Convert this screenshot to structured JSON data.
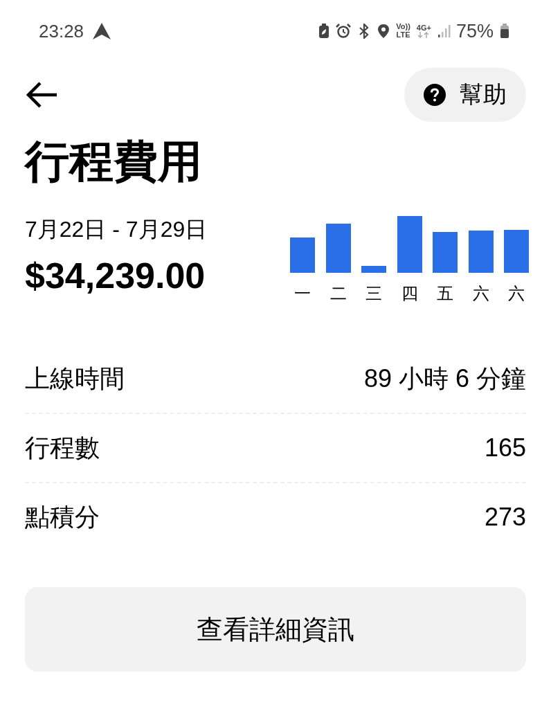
{
  "status_bar": {
    "time": "23:28",
    "volte": "Vo))",
    "lte": "LTE",
    "network": "4G+",
    "battery": "75%"
  },
  "header": {
    "help_button": "幫助"
  },
  "title": "行程費用",
  "summary": {
    "date_range": "7月22日 - 7月29日",
    "amount": "$34,239.00",
    "chart_day_labels": [
      "一",
      "二",
      "三",
      "四",
      "五",
      "六",
      "六"
    ]
  },
  "stats": [
    {
      "label": "上線時間",
      "value": "89 小時 6 分鐘"
    },
    {
      "label": "行程數",
      "value": "165"
    },
    {
      "label": "點積分",
      "value": "273"
    }
  ],
  "details_button": "查看詳細資訊"
}
